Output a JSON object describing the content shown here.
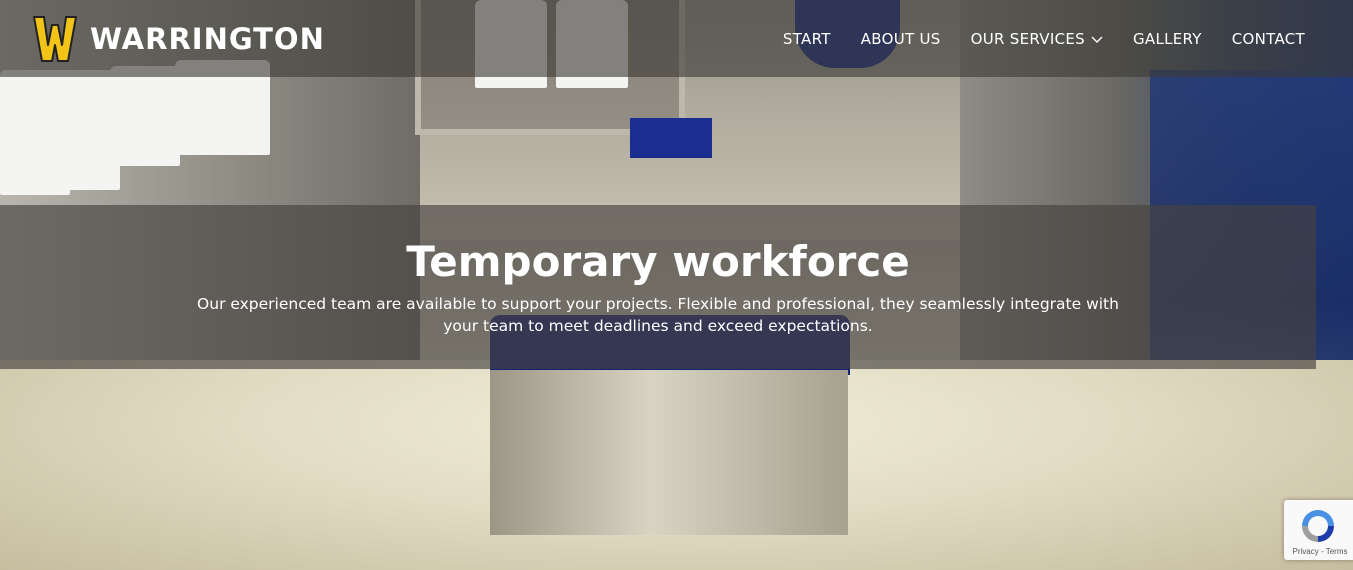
{
  "brand": {
    "name": "WARRINGTON",
    "logo_icon": "w-monogram-logo",
    "logo_colors": {
      "fill": "#f2c418",
      "stroke": "#222222"
    }
  },
  "nav": {
    "items": [
      {
        "label": "START"
      },
      {
        "label": "ABOUT US"
      },
      {
        "label": "OUR SERVICES",
        "has_dropdown": true
      },
      {
        "label": "GALLERY"
      },
      {
        "label": "CONTACT"
      }
    ]
  },
  "hero": {
    "title": "Temporary workforce",
    "text": "Our experienced team are available to support your projects. Flexible and professional, they seamlessly integrate with your team to meet deadlines and exceed expectations."
  },
  "recaptcha": {
    "icon": "recaptcha-icon",
    "terms": "Privacy - Terms"
  },
  "colors": {
    "nav_overlay": "#3c3a36",
    "text": "#ffffff",
    "accent": "#f2c418"
  }
}
